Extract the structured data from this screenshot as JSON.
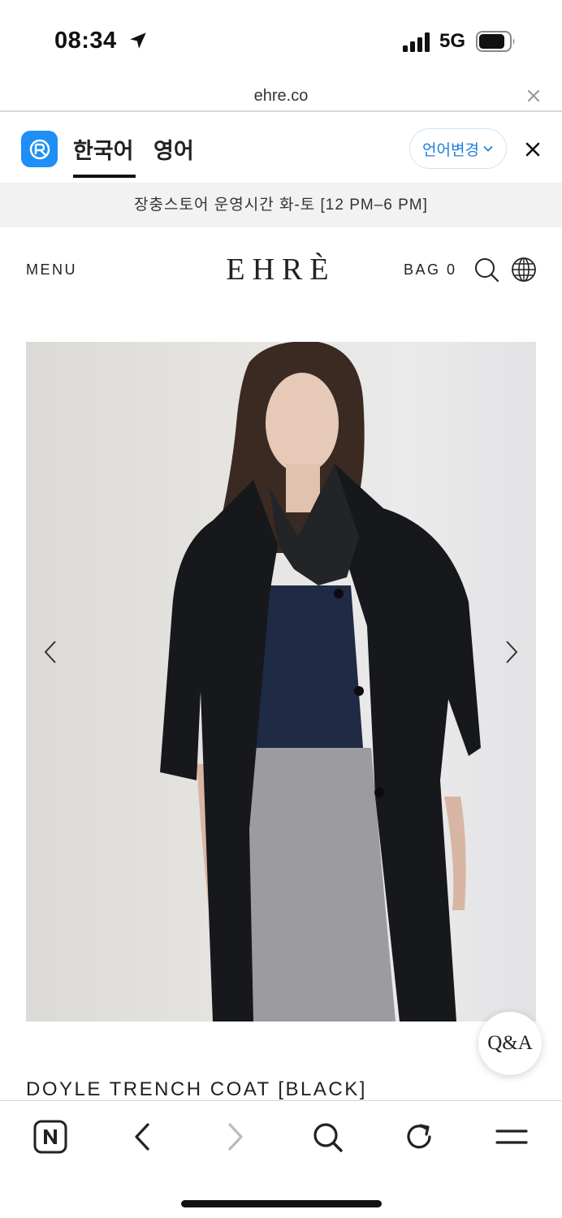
{
  "status_bar": {
    "time": "08:34",
    "network": "5G",
    "icons": [
      "location-arrow-icon",
      "signal-icon",
      "battery-icon"
    ]
  },
  "url_bar": {
    "url": "ehre.co",
    "icons": [
      "close-icon"
    ]
  },
  "translate_bar": {
    "tabs": [
      {
        "label": "한국어",
        "active": true
      },
      {
        "label": "영어",
        "active": false
      }
    ],
    "change_language_label": "언어변경",
    "accent_color": "#1d8ff5",
    "icons": [
      "papago-icon",
      "chevron-down-icon",
      "close-icon"
    ]
  },
  "notice": {
    "text": "장충스토어 운영시간 화-토 [12 PM–6 PM]"
  },
  "site_header": {
    "menu_label": "MENU",
    "logo": "EHRÈ",
    "bag_label": "BAG 0",
    "icons": [
      "search-icon",
      "globe-icon"
    ]
  },
  "product": {
    "title": "DOYLE TRENCH COAT [BLACK]",
    "carousel_icons": [
      "chevron-left-icon",
      "chevron-right-icon"
    ]
  },
  "qna": {
    "label": "Q&A"
  },
  "bottom_toolbar": {
    "icons": [
      "naver-home-icon",
      "back-icon",
      "forward-icon",
      "search-icon",
      "refresh-icon",
      "menu-icon"
    ]
  }
}
